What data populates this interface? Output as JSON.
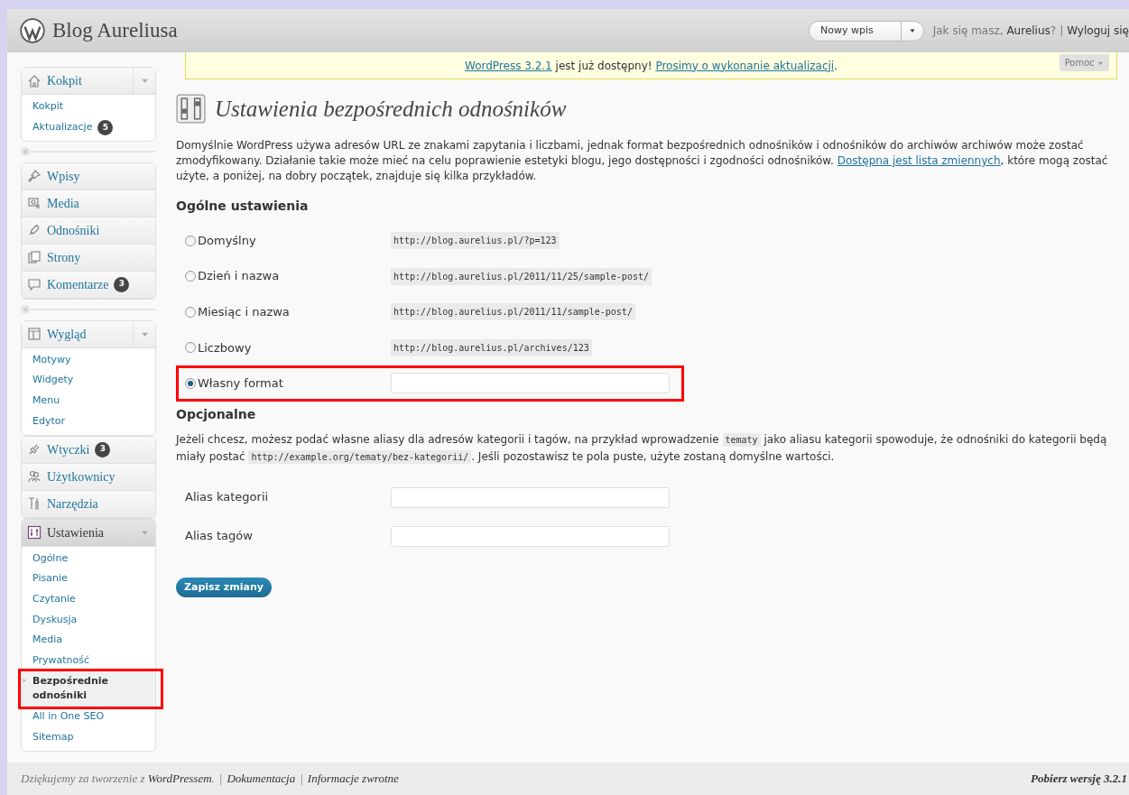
{
  "header": {
    "site_title": "Blog Aureliusa",
    "new_post_select": "Nowy wpis",
    "greeting": "Jak się masz,",
    "user": "Aurelius",
    "greeting_end": "?",
    "separator": "|",
    "logout": "Wyloguj się"
  },
  "help_tab": "Pomoc",
  "notice": [
    {
      "kind": "link",
      "text": "WordPress 3.2.1"
    },
    {
      "kind": "text",
      "text": " jest już dostępny! "
    },
    {
      "kind": "link",
      "text": "Prosimy o wykonanie aktualizacji"
    },
    {
      "kind": "text",
      "text": "."
    }
  ],
  "menu": [
    {
      "kind": "menu",
      "label": "Kokpit",
      "expanded": true,
      "current": false,
      "children": [
        {
          "label": "Kokpit",
          "selected": false,
          "highlighted": false
        },
        {
          "label": "Aktualizacje",
          "badge": "5",
          "selected": false,
          "highlighted": false
        }
      ]
    },
    {
      "kind": "separator"
    },
    {
      "kind": "menu",
      "label": "Wpisy",
      "expanded": false,
      "current": false
    },
    {
      "kind": "menu",
      "label": "Media",
      "expanded": false,
      "current": false
    },
    {
      "kind": "menu",
      "label": "Odnośniki",
      "expanded": false,
      "current": false
    },
    {
      "kind": "menu",
      "label": "Strony",
      "expanded": false,
      "current": false
    },
    {
      "kind": "menu",
      "label": "Komentarze",
      "badge": "3",
      "expanded": false,
      "current": false
    },
    {
      "kind": "separator"
    },
    {
      "kind": "menu",
      "label": "Wygląd",
      "expanded": true,
      "current": false,
      "children": [
        {
          "label": "Motywy",
          "selected": false,
          "highlighted": false
        },
        {
          "label": "Widgety",
          "selected": false,
          "highlighted": false
        },
        {
          "label": "Menu",
          "selected": false,
          "highlighted": false
        },
        {
          "label": "Edytor",
          "selected": false,
          "highlighted": false
        }
      ]
    },
    {
      "kind": "menu",
      "label": "Wtyczki",
      "badge": "3",
      "expanded": false,
      "current": false
    },
    {
      "kind": "menu",
      "label": "Użytkownicy",
      "expanded": false,
      "current": false
    },
    {
      "kind": "menu",
      "label": "Narzędzia",
      "expanded": false,
      "current": false
    },
    {
      "kind": "menu",
      "label": "Ustawienia",
      "expanded": true,
      "current": true,
      "children": [
        {
          "label": "Ogólne",
          "selected": false,
          "highlighted": false
        },
        {
          "label": "Pisanie",
          "selected": false,
          "highlighted": false
        },
        {
          "label": "Czytanie",
          "selected": false,
          "highlighted": false
        },
        {
          "label": "Dyskusja",
          "selected": false,
          "highlighted": false
        },
        {
          "label": "Media",
          "selected": false,
          "highlighted": false
        },
        {
          "label": "Prywatność",
          "selected": false,
          "highlighted": false
        },
        {
          "label": "Bezpośrednie odnośniki",
          "selected": true,
          "highlighted": true
        },
        {
          "label": "All in One SEO",
          "selected": false,
          "highlighted": false
        },
        {
          "label": "Sitemap",
          "selected": false,
          "highlighted": false
        }
      ]
    }
  ],
  "page_title": "Ustawienia bezpośrednich odnośników",
  "intro": [
    {
      "kind": "text",
      "text": "Domyślnie WordPress używa adresów URL ze znakami zapytania i liczbami, jednak format bezpośrednich odnośników i odnośników do archiwów archiwów może zostać zmodyfikowany. Działanie takie może mieć na celu poprawienie estetyki blogu, jego dostępności i zgodności odnośników. "
    },
    {
      "kind": "link",
      "text": "Dostępna jest lista zmiennych"
    },
    {
      "kind": "text",
      "text": ", które mogą zostać użyte, a poniżej, na dobry początek, znajduje się kilka przykładów."
    }
  ],
  "general_heading": "Ogólne ustawienia",
  "options": [
    {
      "kind": "example",
      "label": "Domyślny",
      "example": "http://blog.aurelius.pl/?p=123",
      "selected": false,
      "highlighted": false
    },
    {
      "kind": "example",
      "label": "Dzień i nazwa",
      "example": "http://blog.aurelius.pl/2011/11/25/sample-post/",
      "selected": false,
      "highlighted": false
    },
    {
      "kind": "example",
      "label": "Miesiąc i nazwa",
      "example": "http://blog.aurelius.pl/2011/11/sample-post/",
      "selected": false,
      "highlighted": false
    },
    {
      "kind": "example",
      "label": "Liczbowy",
      "example": "http://blog.aurelius.pl/archives/123",
      "selected": false,
      "highlighted": false
    },
    {
      "kind": "custom",
      "label": "Własny format",
      "selected": true,
      "highlighted": true
    }
  ],
  "optional_heading": "Opcjonalne",
  "optional_text": [
    {
      "kind": "text",
      "text": "Jeżeli chcesz, możesz podać własne aliasy dla adresów kategorii i tagów, na przykład wprowadzenie "
    },
    {
      "kind": "code",
      "text": "tematy"
    },
    {
      "kind": "text",
      "text": " jako aliasu kategorii spowoduje, że odnośniki do kategorii będą miały postać "
    },
    {
      "kind": "code",
      "text": "http://example.org/tematy/bez-kategorii/"
    },
    {
      "kind": "text",
      "text": ". Jeśli pozostawisz te pola puste, użyte zostaną domyślne wartości."
    }
  ],
  "fields": [
    {
      "label": "Alias kategorii"
    },
    {
      "label": "Alias tagów"
    }
  ],
  "save_button": "Zapisz zmiany",
  "footer": {
    "left": [
      {
        "kind": "text",
        "text": "Dziękujemy za tworzenie z "
      },
      {
        "kind": "link",
        "text": "WordPressem"
      },
      {
        "kind": "text",
        "text": ". "
      }
    ],
    "links": [
      "Dokumentacja",
      "Informacje zwrotne"
    ],
    "separator": "|",
    "update": "Pobierz wersję 3.2.1"
  }
}
